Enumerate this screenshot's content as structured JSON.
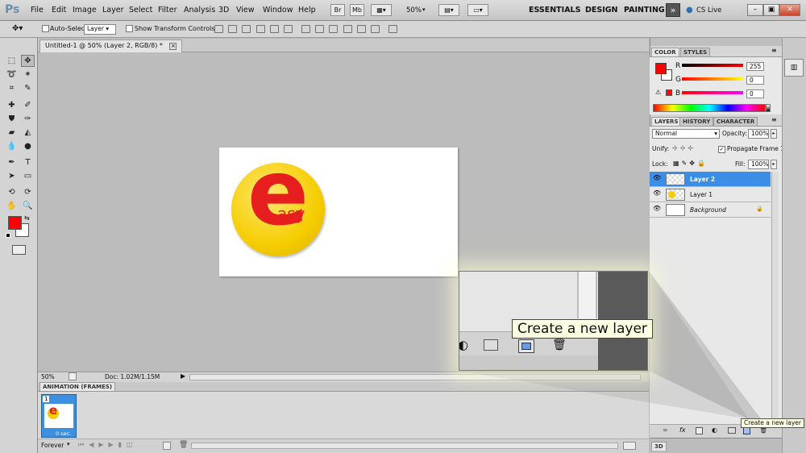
{
  "app": {
    "logo": "Ps"
  },
  "menu": [
    "File",
    "Edit",
    "Image",
    "Layer",
    "Select",
    "Filter",
    "Analysis",
    "3D",
    "View",
    "Window",
    "Help"
  ],
  "toolbar": {
    "bridge": "Br",
    "minibridge": "Mb",
    "zoom_level": "50%"
  },
  "workspaces": [
    "ESSENTIALS",
    "DESIGN",
    "PAINTING"
  ],
  "cs_live": "CS Live",
  "options": {
    "auto_select_label": "Auto-Select:",
    "auto_select_value": "Layer",
    "transform_label": "Show Transform Controls"
  },
  "document": {
    "tab_title": "Untitled-1 @ 50% (Layer 2, RGB/8) *",
    "logo_big": "e",
    "logo_small": "asy"
  },
  "status": {
    "zoom": "50%",
    "doc_size": "Doc: 1.02M/1.15M"
  },
  "animation": {
    "title": "ANIMATION (FRAMES)",
    "frame_number": "1",
    "frame_delay": "0 sec.",
    "loop": "Forever"
  },
  "color_panel": {
    "tabs": [
      "COLOR",
      "STYLES"
    ],
    "r_label": "R",
    "g_label": "G",
    "b_label": "B",
    "r": "255",
    "g": "0",
    "b": "0",
    "foreground": "#ff0000"
  },
  "layers_panel": {
    "tabs": [
      "LAYERS",
      "HISTORY",
      "CHARACTER"
    ],
    "blend_mode": "Normal",
    "opacity_label": "Opacity:",
    "opacity": "100%",
    "unify_label": "Unify:",
    "propagate_label": "Propagate Frame 1",
    "lock_label": "Lock:",
    "fill_label": "Fill:",
    "fill": "100%",
    "layers": [
      {
        "name": "Layer 2",
        "selected": true
      },
      {
        "name": "Layer 1",
        "selected": false
      },
      {
        "name": "Background",
        "selected": false
      }
    ]
  },
  "three_d_label": "3D",
  "tooltip": {
    "big": "Create a new layer",
    "small": "Create a new layer"
  }
}
